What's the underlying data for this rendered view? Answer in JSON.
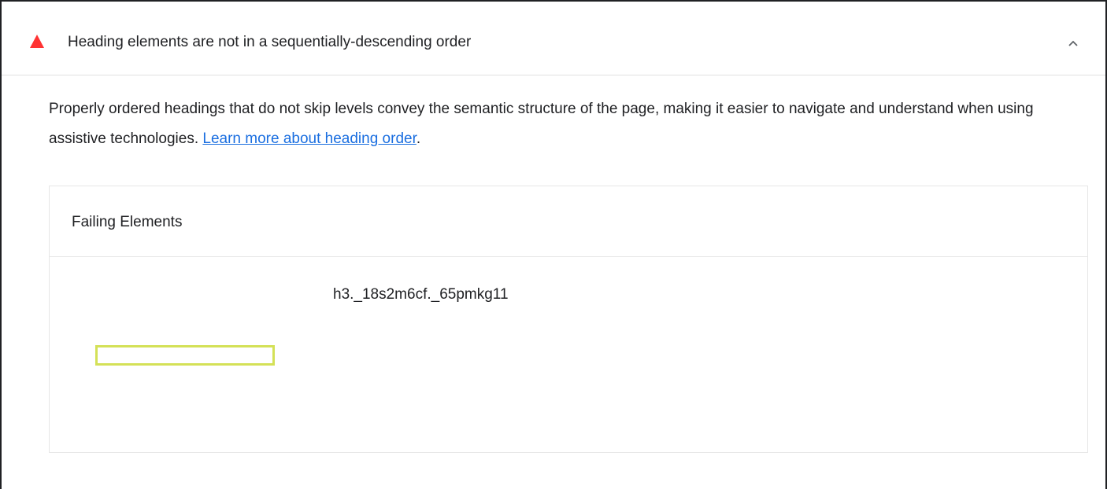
{
  "audit": {
    "title": "Heading elements are not in a sequentially-descending order",
    "status_icon": "fail-triangle-icon",
    "status_color": "#ff3333",
    "expand_icon": "chevron-up-icon",
    "description_text": "Properly ordered headings that do not skip levels convey the semantic structure of the page, making it easier to navigate and understand when using assistive technologies. ",
    "learn_more_label": "Learn more about heading order",
    "description_end": "."
  },
  "details": {
    "header": "Failing Elements",
    "items": [
      {
        "selector": "h3._18s2m6cf._65pmkg11",
        "highlight_color": "#d4e157"
      }
    ]
  }
}
